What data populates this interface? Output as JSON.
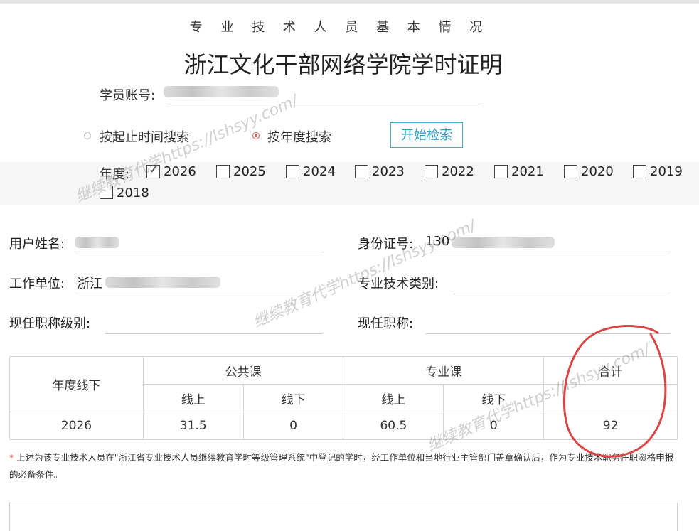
{
  "header": {
    "subtitle": "专 业 技 术 人 员 基 本 情 况",
    "title": "浙江文化干部网络学院学时证明"
  },
  "account": {
    "label": "学员账号:"
  },
  "search": {
    "option_range": "按起止时间搜索",
    "option_year": "按年度搜索",
    "button": "开始检索"
  },
  "years": {
    "label": "年度:",
    "items": [
      {
        "year": "2026",
        "checked": true
      },
      {
        "year": "2025",
        "checked": false
      },
      {
        "year": "2024",
        "checked": false
      },
      {
        "year": "2023",
        "checked": false
      },
      {
        "year": "2022",
        "checked": false
      },
      {
        "year": "2021",
        "checked": false
      },
      {
        "year": "2020",
        "checked": false
      },
      {
        "year": "2019",
        "checked": false
      },
      {
        "year": "2018",
        "checked": false
      }
    ]
  },
  "profile": {
    "name_label": "用户姓名:",
    "id_label": "身份证号:",
    "id_prefix": "130",
    "unit_label": "工作单位:",
    "unit_prefix": "浙江",
    "tech_type_label": "专业技术类别:",
    "title_level_label": "现任职称级别:",
    "title_label": "现任职称:"
  },
  "table": {
    "col_year": "年度线下",
    "col_public": "公共课",
    "col_major": "专业课",
    "col_total": "合计",
    "online": "线上",
    "offline": "线下",
    "row": {
      "year": "2026",
      "public_online": "31.5",
      "public_offline": "0",
      "major_online": "60.5",
      "major_offline": "0",
      "total": "92"
    }
  },
  "note": {
    "star": "*",
    "text": "上述为该专业技术人员在\"浙江省专业技术人员继续教育学时等级管理系统\"中登记的学时，经工作单位和当地行业主管部门盖章确认后，作为专业技术职务任职资格申报的必备条件。"
  },
  "watermark": "继续教育代学https://lshsyy.com/",
  "colors": {
    "accent_red": "#d9534f",
    "button_blue": "#2a9cc2",
    "annotation_red": "#d94545"
  }
}
